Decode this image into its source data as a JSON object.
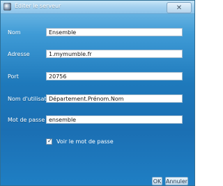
{
  "window": {
    "title": "Éditer le serveur"
  },
  "form": {
    "nom_label": "Nom",
    "nom_value": "Ensemble",
    "adresse_label": "Adresse",
    "adresse_value": "1.mymumble.fr",
    "port_label": "Port",
    "port_value": "20756",
    "username_label": "Nom d'utilisateur",
    "username_value": "Département.Prénom.Nom",
    "password_label": "Mot de passe",
    "password_value": "ensemble",
    "show_password_label": "Voir le mot de passe",
    "show_password_checked": true
  },
  "buttons": {
    "ok": "OK",
    "cancel": "Annuler"
  },
  "icons": {
    "app": "mumble-icon",
    "close": "close-icon"
  },
  "colors": {
    "background_top": "#7fc1e8",
    "background_mid": "#1e79bb",
    "titlebar": "#a7d2ef"
  }
}
